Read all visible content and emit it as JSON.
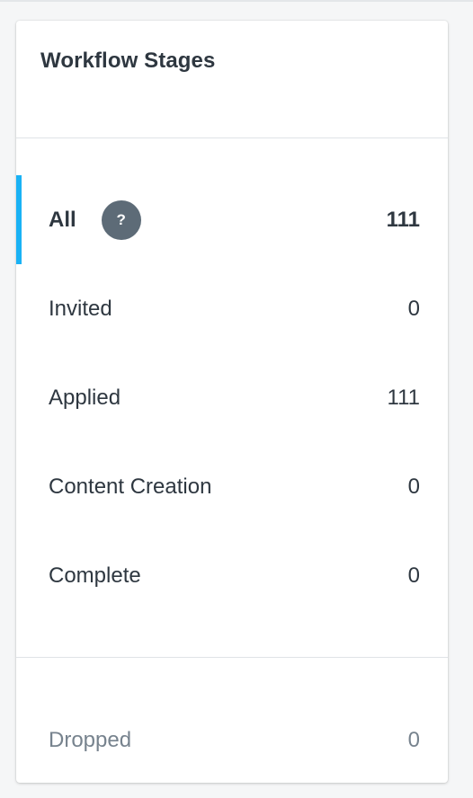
{
  "panel": {
    "title": "Workflow Stages"
  },
  "stages": [
    {
      "label": "All",
      "count": "111",
      "help": "?"
    },
    {
      "label": "Invited",
      "count": "0"
    },
    {
      "label": "Applied",
      "count": "111"
    },
    {
      "label": "Content Creation",
      "count": "0"
    },
    {
      "label": "Complete",
      "count": "0"
    }
  ],
  "dropped": {
    "label": "Dropped",
    "count": "0"
  },
  "colors": {
    "active_indicator": "#1ab2f5",
    "text": "#2e3740",
    "muted_text": "#77838e",
    "help_badge_bg": "#5d6b77"
  },
  "icons": {
    "help": "question-mark-circle"
  }
}
